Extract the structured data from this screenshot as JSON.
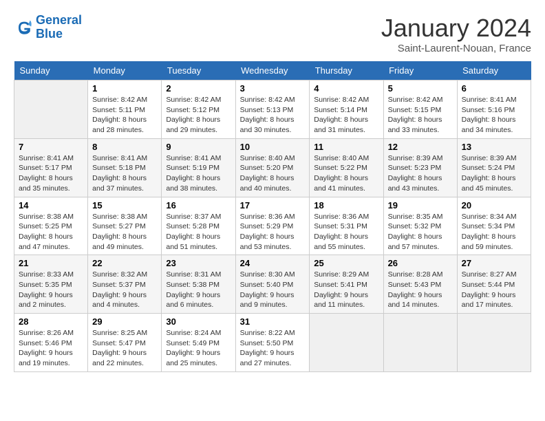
{
  "header": {
    "logo_line1": "General",
    "logo_line2": "Blue",
    "month_title": "January 2024",
    "location": "Saint-Laurent-Nouan, France"
  },
  "weekdays": [
    "Sunday",
    "Monday",
    "Tuesday",
    "Wednesday",
    "Thursday",
    "Friday",
    "Saturday"
  ],
  "weeks": [
    [
      {
        "day": "",
        "sunrise": "",
        "sunset": "",
        "daylight": ""
      },
      {
        "day": "1",
        "sunrise": "Sunrise: 8:42 AM",
        "sunset": "Sunset: 5:11 PM",
        "daylight": "Daylight: 8 hours and 28 minutes."
      },
      {
        "day": "2",
        "sunrise": "Sunrise: 8:42 AM",
        "sunset": "Sunset: 5:12 PM",
        "daylight": "Daylight: 8 hours and 29 minutes."
      },
      {
        "day": "3",
        "sunrise": "Sunrise: 8:42 AM",
        "sunset": "Sunset: 5:13 PM",
        "daylight": "Daylight: 8 hours and 30 minutes."
      },
      {
        "day": "4",
        "sunrise": "Sunrise: 8:42 AM",
        "sunset": "Sunset: 5:14 PM",
        "daylight": "Daylight: 8 hours and 31 minutes."
      },
      {
        "day": "5",
        "sunrise": "Sunrise: 8:42 AM",
        "sunset": "Sunset: 5:15 PM",
        "daylight": "Daylight: 8 hours and 33 minutes."
      },
      {
        "day": "6",
        "sunrise": "Sunrise: 8:41 AM",
        "sunset": "Sunset: 5:16 PM",
        "daylight": "Daylight: 8 hours and 34 minutes."
      }
    ],
    [
      {
        "day": "7",
        "sunrise": "Sunrise: 8:41 AM",
        "sunset": "Sunset: 5:17 PM",
        "daylight": "Daylight: 8 hours and 35 minutes."
      },
      {
        "day": "8",
        "sunrise": "Sunrise: 8:41 AM",
        "sunset": "Sunset: 5:18 PM",
        "daylight": "Daylight: 8 hours and 37 minutes."
      },
      {
        "day": "9",
        "sunrise": "Sunrise: 8:41 AM",
        "sunset": "Sunset: 5:19 PM",
        "daylight": "Daylight: 8 hours and 38 minutes."
      },
      {
        "day": "10",
        "sunrise": "Sunrise: 8:40 AM",
        "sunset": "Sunset: 5:20 PM",
        "daylight": "Daylight: 8 hours and 40 minutes."
      },
      {
        "day": "11",
        "sunrise": "Sunrise: 8:40 AM",
        "sunset": "Sunset: 5:22 PM",
        "daylight": "Daylight: 8 hours and 41 minutes."
      },
      {
        "day": "12",
        "sunrise": "Sunrise: 8:39 AM",
        "sunset": "Sunset: 5:23 PM",
        "daylight": "Daylight: 8 hours and 43 minutes."
      },
      {
        "day": "13",
        "sunrise": "Sunrise: 8:39 AM",
        "sunset": "Sunset: 5:24 PM",
        "daylight": "Daylight: 8 hours and 45 minutes."
      }
    ],
    [
      {
        "day": "14",
        "sunrise": "Sunrise: 8:38 AM",
        "sunset": "Sunset: 5:25 PM",
        "daylight": "Daylight: 8 hours and 47 minutes."
      },
      {
        "day": "15",
        "sunrise": "Sunrise: 8:38 AM",
        "sunset": "Sunset: 5:27 PM",
        "daylight": "Daylight: 8 hours and 49 minutes."
      },
      {
        "day": "16",
        "sunrise": "Sunrise: 8:37 AM",
        "sunset": "Sunset: 5:28 PM",
        "daylight": "Daylight: 8 hours and 51 minutes."
      },
      {
        "day": "17",
        "sunrise": "Sunrise: 8:36 AM",
        "sunset": "Sunset: 5:29 PM",
        "daylight": "Daylight: 8 hours and 53 minutes."
      },
      {
        "day": "18",
        "sunrise": "Sunrise: 8:36 AM",
        "sunset": "Sunset: 5:31 PM",
        "daylight": "Daylight: 8 hours and 55 minutes."
      },
      {
        "day": "19",
        "sunrise": "Sunrise: 8:35 AM",
        "sunset": "Sunset: 5:32 PM",
        "daylight": "Daylight: 8 hours and 57 minutes."
      },
      {
        "day": "20",
        "sunrise": "Sunrise: 8:34 AM",
        "sunset": "Sunset: 5:34 PM",
        "daylight": "Daylight: 8 hours and 59 minutes."
      }
    ],
    [
      {
        "day": "21",
        "sunrise": "Sunrise: 8:33 AM",
        "sunset": "Sunset: 5:35 PM",
        "daylight": "Daylight: 9 hours and 2 minutes."
      },
      {
        "day": "22",
        "sunrise": "Sunrise: 8:32 AM",
        "sunset": "Sunset: 5:37 PM",
        "daylight": "Daylight: 9 hours and 4 minutes."
      },
      {
        "day": "23",
        "sunrise": "Sunrise: 8:31 AM",
        "sunset": "Sunset: 5:38 PM",
        "daylight": "Daylight: 9 hours and 6 minutes."
      },
      {
        "day": "24",
        "sunrise": "Sunrise: 8:30 AM",
        "sunset": "Sunset: 5:40 PM",
        "daylight": "Daylight: 9 hours and 9 minutes."
      },
      {
        "day": "25",
        "sunrise": "Sunrise: 8:29 AM",
        "sunset": "Sunset: 5:41 PM",
        "daylight": "Daylight: 9 hours and 11 minutes."
      },
      {
        "day": "26",
        "sunrise": "Sunrise: 8:28 AM",
        "sunset": "Sunset: 5:43 PM",
        "daylight": "Daylight: 9 hours and 14 minutes."
      },
      {
        "day": "27",
        "sunrise": "Sunrise: 8:27 AM",
        "sunset": "Sunset: 5:44 PM",
        "daylight": "Daylight: 9 hours and 17 minutes."
      }
    ],
    [
      {
        "day": "28",
        "sunrise": "Sunrise: 8:26 AM",
        "sunset": "Sunset: 5:46 PM",
        "daylight": "Daylight: 9 hours and 19 minutes."
      },
      {
        "day": "29",
        "sunrise": "Sunrise: 8:25 AM",
        "sunset": "Sunset: 5:47 PM",
        "daylight": "Daylight: 9 hours and 22 minutes."
      },
      {
        "day": "30",
        "sunrise": "Sunrise: 8:24 AM",
        "sunset": "Sunset: 5:49 PM",
        "daylight": "Daylight: 9 hours and 25 minutes."
      },
      {
        "day": "31",
        "sunrise": "Sunrise: 8:22 AM",
        "sunset": "Sunset: 5:50 PM",
        "daylight": "Daylight: 9 hours and 27 minutes."
      },
      {
        "day": "",
        "sunrise": "",
        "sunset": "",
        "daylight": ""
      },
      {
        "day": "",
        "sunrise": "",
        "sunset": "",
        "daylight": ""
      },
      {
        "day": "",
        "sunrise": "",
        "sunset": "",
        "daylight": ""
      }
    ]
  ]
}
